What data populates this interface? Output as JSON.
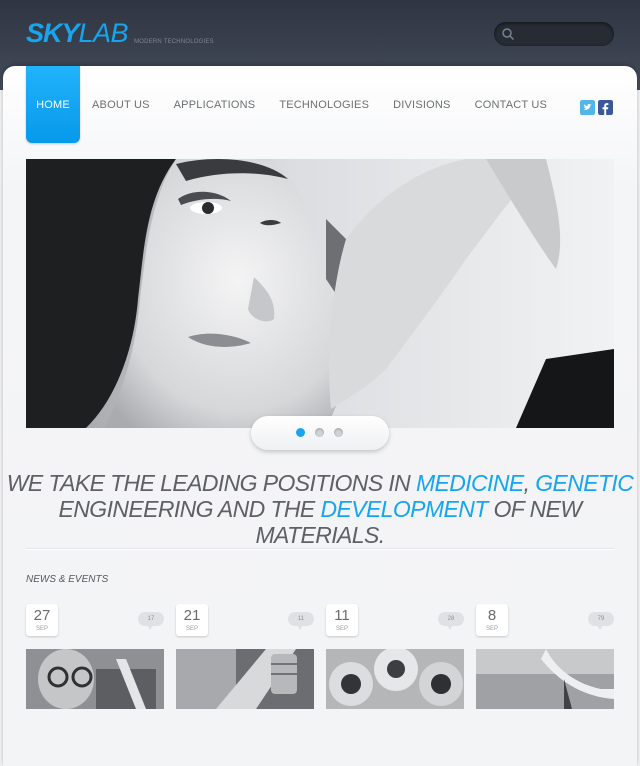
{
  "logo": {
    "brand_bold": "SKY",
    "brand_light": "LAB",
    "tagline": "MODERN TECHNOLOGIES"
  },
  "search": {
    "value": "",
    "placeholder": ""
  },
  "nav": {
    "items": [
      {
        "label": "HOME",
        "active": true
      },
      {
        "label": "ABOUT US"
      },
      {
        "label": "APPLICATIONS"
      },
      {
        "label": "TECHNOLOGIES"
      },
      {
        "label": "DIVISIONS"
      },
      {
        "label": "CONTACT US"
      }
    ]
  },
  "social": {
    "twitter_icon": "twitter-icon",
    "facebook_icon": "facebook-icon",
    "twitter_color": "#52b6e8",
    "facebook_color": "#3b5998"
  },
  "slider": {
    "total_slides": 3,
    "active_slide": 1
  },
  "tagline": {
    "part1": "WE TAKE THE LEADING POSITIONS IN ",
    "highlight1": "MEDICINE",
    "part2": ", ",
    "highlight2": "GENETIC",
    "part3": "ENGINEERING AND THE ",
    "highlight3": "DEVELOPMENT",
    "part4": " OF NEW MATERIALS."
  },
  "news": {
    "title": "NEWS & EVENTS",
    "items": [
      {
        "day": "27",
        "month": "SEP",
        "comments": "17"
      },
      {
        "day": "21",
        "month": "SEP",
        "comments": "11"
      },
      {
        "day": "11",
        "month": "SEP",
        "comments": "28"
      },
      {
        "day": "8",
        "month": "SEP",
        "comments": "79"
      }
    ]
  },
  "colors": {
    "accent": "#16a6ee",
    "header_bg": "#353b47",
    "text": "#5f6064"
  }
}
